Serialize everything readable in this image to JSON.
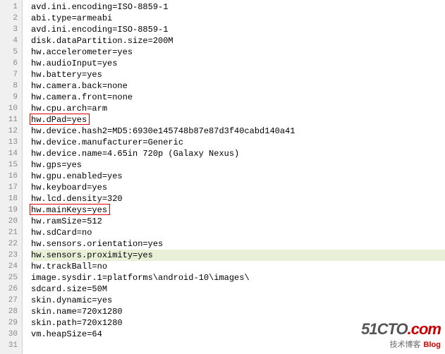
{
  "lines": [
    "avd.ini.encoding=ISO-8859-1",
    "abi.type=armeabi",
    "avd.ini.encoding=ISO-8859-1",
    "disk.dataPartition.size=200M",
    "hw.accelerometer=yes",
    "hw.audioInput=yes",
    "hw.battery=yes",
    "hw.camera.back=none",
    "hw.camera.front=none",
    "hw.cpu.arch=arm",
    "hw.dPad=yes",
    "hw.device.hash2=MD5:6930e145748b87e87d3f40cabd140a41",
    "hw.device.manufacturer=Generic",
    "hw.device.name=4.65in 720p (Galaxy Nexus)",
    "hw.gps=yes",
    "hw.gpu.enabled=yes",
    "hw.keyboard=yes",
    "hw.lcd.density=320",
    "hw.mainKeys=yes",
    "hw.ramSize=512",
    "hw.sdCard=no",
    "hw.sensors.orientation=yes",
    "hw.sensors.proximity=yes",
    "hw.trackBall=no",
    "image.sysdir.1=platforms\\android-10\\images\\",
    "sdcard.size=50M",
    "skin.dynamic=yes",
    "skin.name=720x1280",
    "skin.path=720x1280",
    "vm.heapSize=64",
    ""
  ],
  "highlighted_line_index": 22,
  "boxed_line_indices": [
    10,
    18
  ],
  "line_numbers": [
    "1",
    "2",
    "3",
    "4",
    "5",
    "6",
    "7",
    "8",
    "9",
    "10",
    "11",
    "12",
    "13",
    "14",
    "15",
    "16",
    "17",
    "18",
    "19",
    "20",
    "21",
    "22",
    "23",
    "24",
    "25",
    "26",
    "27",
    "28",
    "29",
    "30",
    "31"
  ],
  "watermark": {
    "logo_main": "51CTO",
    "logo_suffix": ".com",
    "sub_cn": "技术博客",
    "sub_en": "Blog"
  }
}
